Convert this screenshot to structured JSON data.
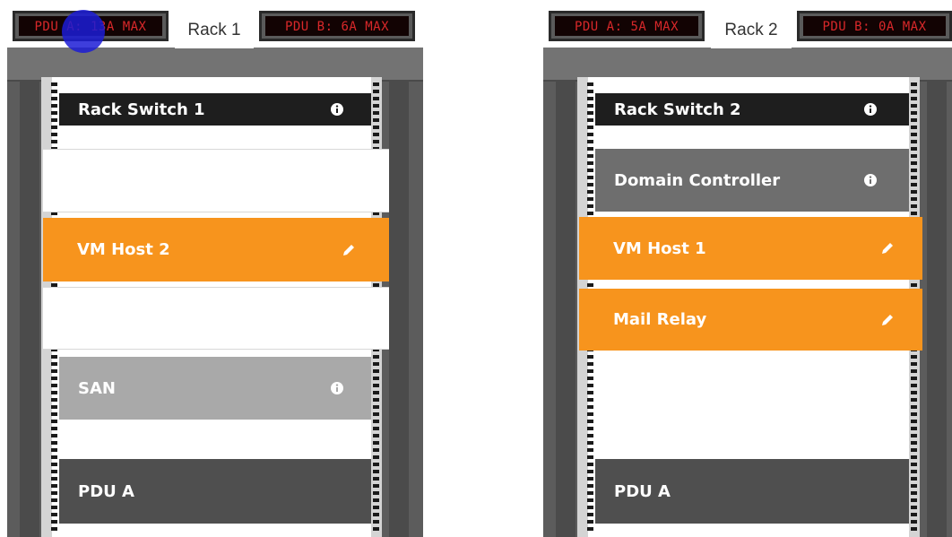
{
  "rack1": {
    "pdu_a": "PDU A: 13A MAX",
    "tab": "Rack 1",
    "pdu_b": "PDU B: 6A MAX",
    "devices": [
      {
        "name": "Rack Switch 1",
        "action": "info"
      },
      {
        "name": "VM Host 2",
        "action": "edit"
      },
      {
        "name": "SAN",
        "action": "info"
      },
      {
        "name": "PDU A",
        "action": ""
      }
    ]
  },
  "rack2": {
    "pdu_a": "PDU A: 5A MAX",
    "tab": "Rack 2",
    "pdu_b": "PDU B: 0A MAX",
    "devices": [
      {
        "name": "Rack Switch 2",
        "action": "info"
      },
      {
        "name": "Domain Controller",
        "action": "info"
      },
      {
        "name": "VM Host 1",
        "action": "edit"
      },
      {
        "name": "Mail Relay",
        "action": "edit"
      },
      {
        "name": "PDU A",
        "action": ""
      }
    ]
  },
  "colors": {
    "switch": "#1e1e1e",
    "vm_host": "#f7941d",
    "san": "#a9a9a9",
    "domain_controller": "#6e6e6e",
    "pdu": "#4f4f4f",
    "led_text": "#d9282a",
    "cursor": "#1c1cd6"
  },
  "icons": {
    "info": "info-circle-icon",
    "edit": "pencil-icon"
  }
}
